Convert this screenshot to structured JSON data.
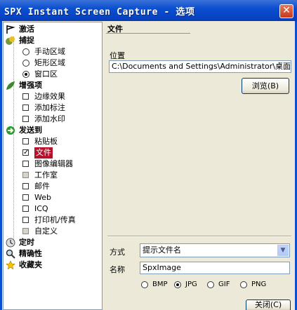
{
  "window": {
    "title": "SPX Instant Screen Capture - 选项",
    "close_glyph": "✕"
  },
  "tree": {
    "activate": "激活",
    "capture": "捕捉",
    "capture_items": [
      {
        "label": "手动区域",
        "checked": false
      },
      {
        "label": "矩形区域",
        "checked": false
      },
      {
        "label": "窗口区",
        "checked": true
      }
    ],
    "enhance": "增强项",
    "enhance_items": [
      {
        "label": "边缘效果",
        "checked": false
      },
      {
        "label": "添加标注",
        "checked": false
      },
      {
        "label": "添加水印",
        "checked": false
      }
    ],
    "sendto": "发送到",
    "sendto_items": [
      {
        "label": "粘贴板",
        "checked": false
      },
      {
        "label": "文件",
        "checked": true
      },
      {
        "label": "图像编辑器",
        "checked": false
      },
      {
        "label": "工作室",
        "checked": false,
        "gray": true
      },
      {
        "label": "邮件",
        "checked": false
      },
      {
        "label": "Web",
        "checked": false
      },
      {
        "label": "ICQ",
        "checked": false
      },
      {
        "label": "打印机/传真",
        "checked": false
      },
      {
        "label": "自定义",
        "checked": false,
        "gray": true
      }
    ],
    "timer": "定时",
    "precision": "精确性",
    "favorites": "收藏夹"
  },
  "panel": {
    "header": "文件",
    "location_label": "位置",
    "location_value": "C:\\Documents and Settings\\Administrator\\桌面\\",
    "browse_label": "浏览(B)",
    "mode_label": "方式",
    "mode_value": "提示文件名",
    "name_label": "名称",
    "name_value": "SpxImage",
    "formats": [
      {
        "label": "BMP",
        "selected": false
      },
      {
        "label": "JPG",
        "selected": true
      },
      {
        "label": "GIF",
        "selected": false
      },
      {
        "label": "PNG",
        "selected": false
      }
    ],
    "close_label": "关闭(C)"
  }
}
